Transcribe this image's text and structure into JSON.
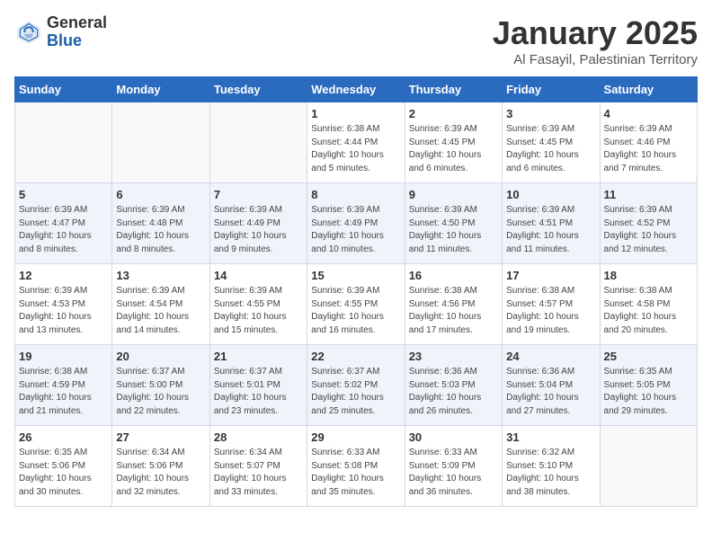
{
  "header": {
    "logo_general": "General",
    "logo_blue": "Blue",
    "title": "January 2025",
    "subtitle": "Al Fasayil, Palestinian Territory"
  },
  "days_of_week": [
    "Sunday",
    "Monday",
    "Tuesday",
    "Wednesday",
    "Thursday",
    "Friday",
    "Saturday"
  ],
  "weeks": [
    [
      {
        "day": "",
        "info": ""
      },
      {
        "day": "",
        "info": ""
      },
      {
        "day": "",
        "info": ""
      },
      {
        "day": "1",
        "info": "Sunrise: 6:38 AM\nSunset: 4:44 PM\nDaylight: 10 hours\nand 5 minutes."
      },
      {
        "day": "2",
        "info": "Sunrise: 6:39 AM\nSunset: 4:45 PM\nDaylight: 10 hours\nand 6 minutes."
      },
      {
        "day": "3",
        "info": "Sunrise: 6:39 AM\nSunset: 4:45 PM\nDaylight: 10 hours\nand 6 minutes."
      },
      {
        "day": "4",
        "info": "Sunrise: 6:39 AM\nSunset: 4:46 PM\nDaylight: 10 hours\nand 7 minutes."
      }
    ],
    [
      {
        "day": "5",
        "info": "Sunrise: 6:39 AM\nSunset: 4:47 PM\nDaylight: 10 hours\nand 8 minutes."
      },
      {
        "day": "6",
        "info": "Sunrise: 6:39 AM\nSunset: 4:48 PM\nDaylight: 10 hours\nand 8 minutes."
      },
      {
        "day": "7",
        "info": "Sunrise: 6:39 AM\nSunset: 4:49 PM\nDaylight: 10 hours\nand 9 minutes."
      },
      {
        "day": "8",
        "info": "Sunrise: 6:39 AM\nSunset: 4:49 PM\nDaylight: 10 hours\nand 10 minutes."
      },
      {
        "day": "9",
        "info": "Sunrise: 6:39 AM\nSunset: 4:50 PM\nDaylight: 10 hours\nand 11 minutes."
      },
      {
        "day": "10",
        "info": "Sunrise: 6:39 AM\nSunset: 4:51 PM\nDaylight: 10 hours\nand 11 minutes."
      },
      {
        "day": "11",
        "info": "Sunrise: 6:39 AM\nSunset: 4:52 PM\nDaylight: 10 hours\nand 12 minutes."
      }
    ],
    [
      {
        "day": "12",
        "info": "Sunrise: 6:39 AM\nSunset: 4:53 PM\nDaylight: 10 hours\nand 13 minutes."
      },
      {
        "day": "13",
        "info": "Sunrise: 6:39 AM\nSunset: 4:54 PM\nDaylight: 10 hours\nand 14 minutes."
      },
      {
        "day": "14",
        "info": "Sunrise: 6:39 AM\nSunset: 4:55 PM\nDaylight: 10 hours\nand 15 minutes."
      },
      {
        "day": "15",
        "info": "Sunrise: 6:39 AM\nSunset: 4:55 PM\nDaylight: 10 hours\nand 16 minutes."
      },
      {
        "day": "16",
        "info": "Sunrise: 6:38 AM\nSunset: 4:56 PM\nDaylight: 10 hours\nand 17 minutes."
      },
      {
        "day": "17",
        "info": "Sunrise: 6:38 AM\nSunset: 4:57 PM\nDaylight: 10 hours\nand 19 minutes."
      },
      {
        "day": "18",
        "info": "Sunrise: 6:38 AM\nSunset: 4:58 PM\nDaylight: 10 hours\nand 20 minutes."
      }
    ],
    [
      {
        "day": "19",
        "info": "Sunrise: 6:38 AM\nSunset: 4:59 PM\nDaylight: 10 hours\nand 21 minutes."
      },
      {
        "day": "20",
        "info": "Sunrise: 6:37 AM\nSunset: 5:00 PM\nDaylight: 10 hours\nand 22 minutes."
      },
      {
        "day": "21",
        "info": "Sunrise: 6:37 AM\nSunset: 5:01 PM\nDaylight: 10 hours\nand 23 minutes."
      },
      {
        "day": "22",
        "info": "Sunrise: 6:37 AM\nSunset: 5:02 PM\nDaylight: 10 hours\nand 25 minutes."
      },
      {
        "day": "23",
        "info": "Sunrise: 6:36 AM\nSunset: 5:03 PM\nDaylight: 10 hours\nand 26 minutes."
      },
      {
        "day": "24",
        "info": "Sunrise: 6:36 AM\nSunset: 5:04 PM\nDaylight: 10 hours\nand 27 minutes."
      },
      {
        "day": "25",
        "info": "Sunrise: 6:35 AM\nSunset: 5:05 PM\nDaylight: 10 hours\nand 29 minutes."
      }
    ],
    [
      {
        "day": "26",
        "info": "Sunrise: 6:35 AM\nSunset: 5:06 PM\nDaylight: 10 hours\nand 30 minutes."
      },
      {
        "day": "27",
        "info": "Sunrise: 6:34 AM\nSunset: 5:06 PM\nDaylight: 10 hours\nand 32 minutes."
      },
      {
        "day": "28",
        "info": "Sunrise: 6:34 AM\nSunset: 5:07 PM\nDaylight: 10 hours\nand 33 minutes."
      },
      {
        "day": "29",
        "info": "Sunrise: 6:33 AM\nSunset: 5:08 PM\nDaylight: 10 hours\nand 35 minutes."
      },
      {
        "day": "30",
        "info": "Sunrise: 6:33 AM\nSunset: 5:09 PM\nDaylight: 10 hours\nand 36 minutes."
      },
      {
        "day": "31",
        "info": "Sunrise: 6:32 AM\nSunset: 5:10 PM\nDaylight: 10 hours\nand 38 minutes."
      },
      {
        "day": "",
        "info": ""
      }
    ]
  ]
}
